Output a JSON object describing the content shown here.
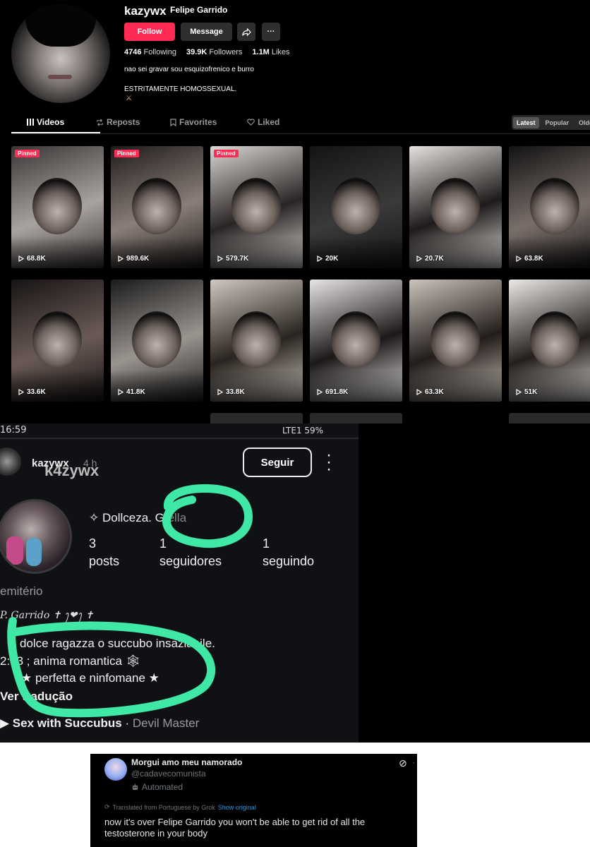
{
  "tiktok": {
    "username": "kazywx",
    "nickname": "Felipe Garrido",
    "follow_label": "Follow",
    "message_label": "Message",
    "more_label": "···",
    "stats": {
      "following_count": "4746",
      "following_label": "Following",
      "followers_count": "39.9K",
      "followers_label": "Followers",
      "likes_count": "1.1M",
      "likes_label": "Likes"
    },
    "bio_line1": "nao sei gravar sou esquizofrenico e burro",
    "bio_line2": "ESTRITAMENTE HOMOSSEXUAL.",
    "bio_line3": "⚔",
    "tabs": [
      {
        "label": "Videos",
        "icon": "grid-icon"
      },
      {
        "label": "Reposts",
        "icon": "repost-icon"
      },
      {
        "label": "Favorites",
        "icon": "bookmark-icon"
      },
      {
        "label": "Liked",
        "icon": "heart-outline-icon"
      }
    ],
    "sort": [
      "Latest",
      "Popular",
      "Oldest"
    ],
    "pinned_label": "Pinned",
    "videos": [
      {
        "views": "68.8K",
        "pinned": true
      },
      {
        "views": "989.6K",
        "pinned": true
      },
      {
        "views": "579.7K",
        "pinned": true
      },
      {
        "views": "20K",
        "pinned": false
      },
      {
        "views": "20.7K",
        "pinned": false
      },
      {
        "views": "63.8K",
        "pinned": false
      },
      {
        "views": "33.6K",
        "pinned": false
      },
      {
        "views": "41.8K",
        "pinned": false
      },
      {
        "views": "33.8K",
        "pinned": false
      },
      {
        "views": "691.8K",
        "pinned": false
      },
      {
        "views": "63.3K",
        "pinned": false
      },
      {
        "views": "51K",
        "pinned": false
      }
    ]
  },
  "instagram": {
    "status_time": "16:59",
    "status_battery": "LTE1 59%",
    "handle_small": "kazywx",
    "age": "4 h",
    "handle": "k4zywx",
    "follow_label": "Seguir",
    "display_name": "✧ Dollceza. G",
    "display_name_suffix": "ella",
    "posts_count": "3",
    "posts_label": "posts",
    "followers_count": "1",
    "followers_label": "seguidores",
    "following_count": "1",
    "following_label": "seguindo",
    "category": "emitério",
    "signature": "P. Garrido ✝ ꫂ❤ꫂ ✝",
    "bio_line1": "dolce ragazza o succubo insaziabile.",
    "bio_line2": "2:33 ;  anima romantica 🕸",
    "bio_line3": "★ perfetta e ninfomane ★",
    "translate_label": "Ver tradução",
    "music_title": "Sex with Succubus",
    "music_artist": "Devil Master",
    "scribble_color": "#3fe8a4"
  },
  "tweet": {
    "name": "Morgui amo meu namorado",
    "handle": "@cadavecomunista",
    "automated": "Automated",
    "translated_from": "Translated from Portuguese by Grok",
    "show_original": "Show original",
    "text": "now it's over Felipe Garrido you won't be able to get rid of all the testosterone in your body"
  }
}
